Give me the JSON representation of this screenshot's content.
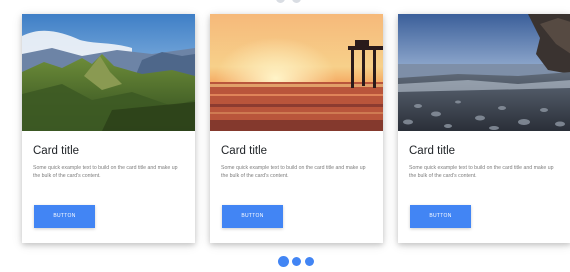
{
  "cards": [
    {
      "title": "Card title",
      "text": "Some quick example text to build on the card title and make up the bulk of the card's content.",
      "button": "Button"
    },
    {
      "title": "Card title",
      "text": "Some quick example text to build on the card title and make up the bulk of the card's content.",
      "button": "Button"
    },
    {
      "title": "Card title",
      "text": "Some quick example text to build on the card title and make up the bulk of the card's content.",
      "button": "Button"
    }
  ],
  "carousel": {
    "slide_count": 3,
    "active_slide": 1
  },
  "colors": {
    "button": "#4285f4",
    "indicator": "#4285f4",
    "title": "#212529",
    "body_text": "#7d7d7d"
  }
}
